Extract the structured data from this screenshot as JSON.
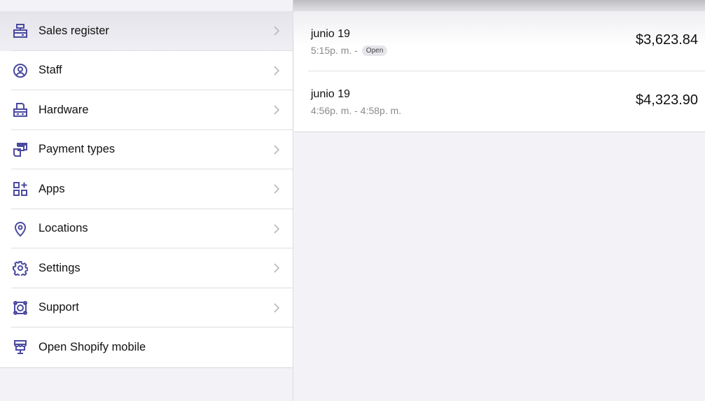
{
  "sidebar": {
    "items": [
      {
        "label": "Sales register",
        "icon": "register-icon",
        "selected": true,
        "chevron": true
      },
      {
        "label": "Staff",
        "icon": "user-circle-icon",
        "chevron": true
      },
      {
        "label": "Hardware",
        "icon": "printer-icon",
        "chevron": true
      },
      {
        "label": "Payment types",
        "icon": "cards-icon",
        "chevron": true
      },
      {
        "label": "Apps",
        "icon": "apps-icon",
        "chevron": true
      },
      {
        "label": "Locations",
        "icon": "location-pin-icon",
        "chevron": true
      },
      {
        "label": "Settings",
        "icon": "gear-icon",
        "chevron": true
      },
      {
        "label": "Support",
        "icon": "lifebuoy-icon",
        "chevron": true
      },
      {
        "label": "Open Shopify mobile",
        "icon": "store-icon",
        "chevron": false
      }
    ]
  },
  "shifts": [
    {
      "date": "junio 19",
      "time": "5:15p. m. -",
      "badge": "Open",
      "amount": "$3,623.84"
    },
    {
      "date": "junio 19",
      "time": "4:56p. m. - 4:58p. m.",
      "amount": "$4,323.90"
    }
  ],
  "colors": {
    "icon": "#4a4aa0",
    "chevron": "#b8b8bd"
  }
}
